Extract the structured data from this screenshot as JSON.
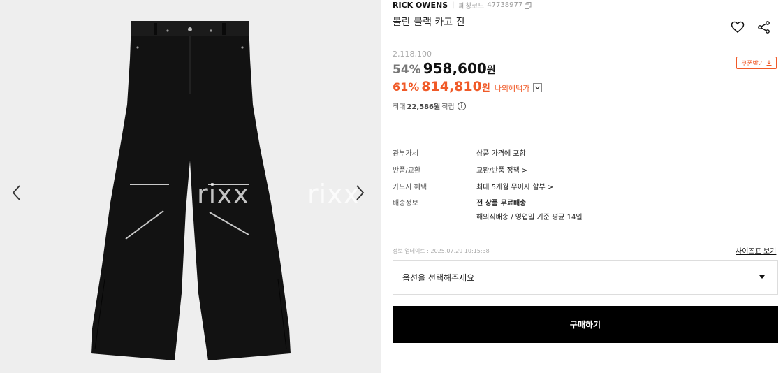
{
  "gallery": {
    "watermark": "rixx",
    "prev_icon": "chevron-left-icon",
    "next_icon": "chevron-right-icon"
  },
  "product": {
    "brand": "RICK OWENS",
    "code_label": "페칭코드",
    "code": "47738977",
    "title": "볼란 블랙 카고 진",
    "original_price": "2,118,100",
    "discount": "54%",
    "price": "958,600",
    "currency": "원",
    "coupon_label": "쿠폰받기",
    "benefit_discount": "61%",
    "benefit_price": "814,810",
    "benefit_label": "나의혜택가",
    "points_prefix": "최대",
    "points_amount": "22,586원",
    "points_suffix": "적립"
  },
  "specs": [
    {
      "label": "관부가세",
      "value": "상품 가격에 포함"
    },
    {
      "label": "반품/교환",
      "value": "교환/반품 정책 >"
    },
    {
      "label": "카드사 혜택",
      "value": "최대 5개월 무이자 할부 >"
    },
    {
      "label": "배송정보",
      "value": "전 상품 무료배송",
      "value2": "해외직배송 / 영업일 기준 평균 14일"
    }
  ],
  "footer": {
    "update_text": "정보 업데이트 : 2025.07.29 10:15:38",
    "size_chart": "사이즈표 보기",
    "option_placeholder": "옵션을 선택해주세요",
    "buy_label": "구매하기"
  },
  "colors": {
    "accent": "#f05a28",
    "buy_bg": "#000000"
  }
}
